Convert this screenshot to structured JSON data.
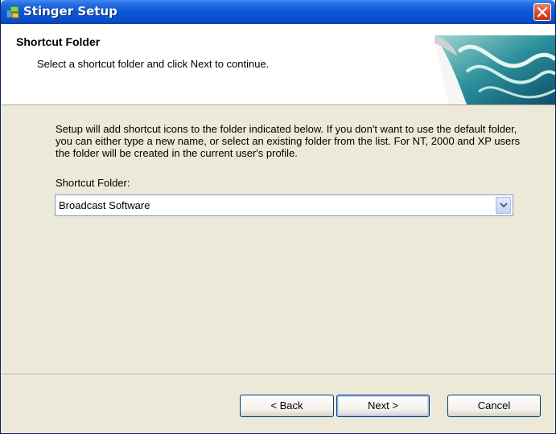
{
  "window": {
    "title": "Stinger Setup"
  },
  "header": {
    "title": "Shortcut Folder",
    "subtitle": "Select a shortcut folder and click Next to continue."
  },
  "content": {
    "description": "Setup will add shortcut icons to the folder indicated below. If you don't want to use the default folder, you can either type a new name, or select an existing folder from the list. For NT, 2000 and XP users the folder will be created in the current user's profile.",
    "field_label": "Shortcut Folder:",
    "field_value": "Broadcast Software"
  },
  "buttons": {
    "back": "< Back",
    "next": "Next >",
    "cancel": "Cancel"
  },
  "colors": {
    "titlebar": "#0a58d8",
    "close": "#d34521",
    "dialog_bg": "#ece9d8"
  },
  "icons": {
    "app": "setup-app-icon",
    "close": "close-icon",
    "dropdown": "chevron-down-icon",
    "banner": "wave-banner"
  }
}
